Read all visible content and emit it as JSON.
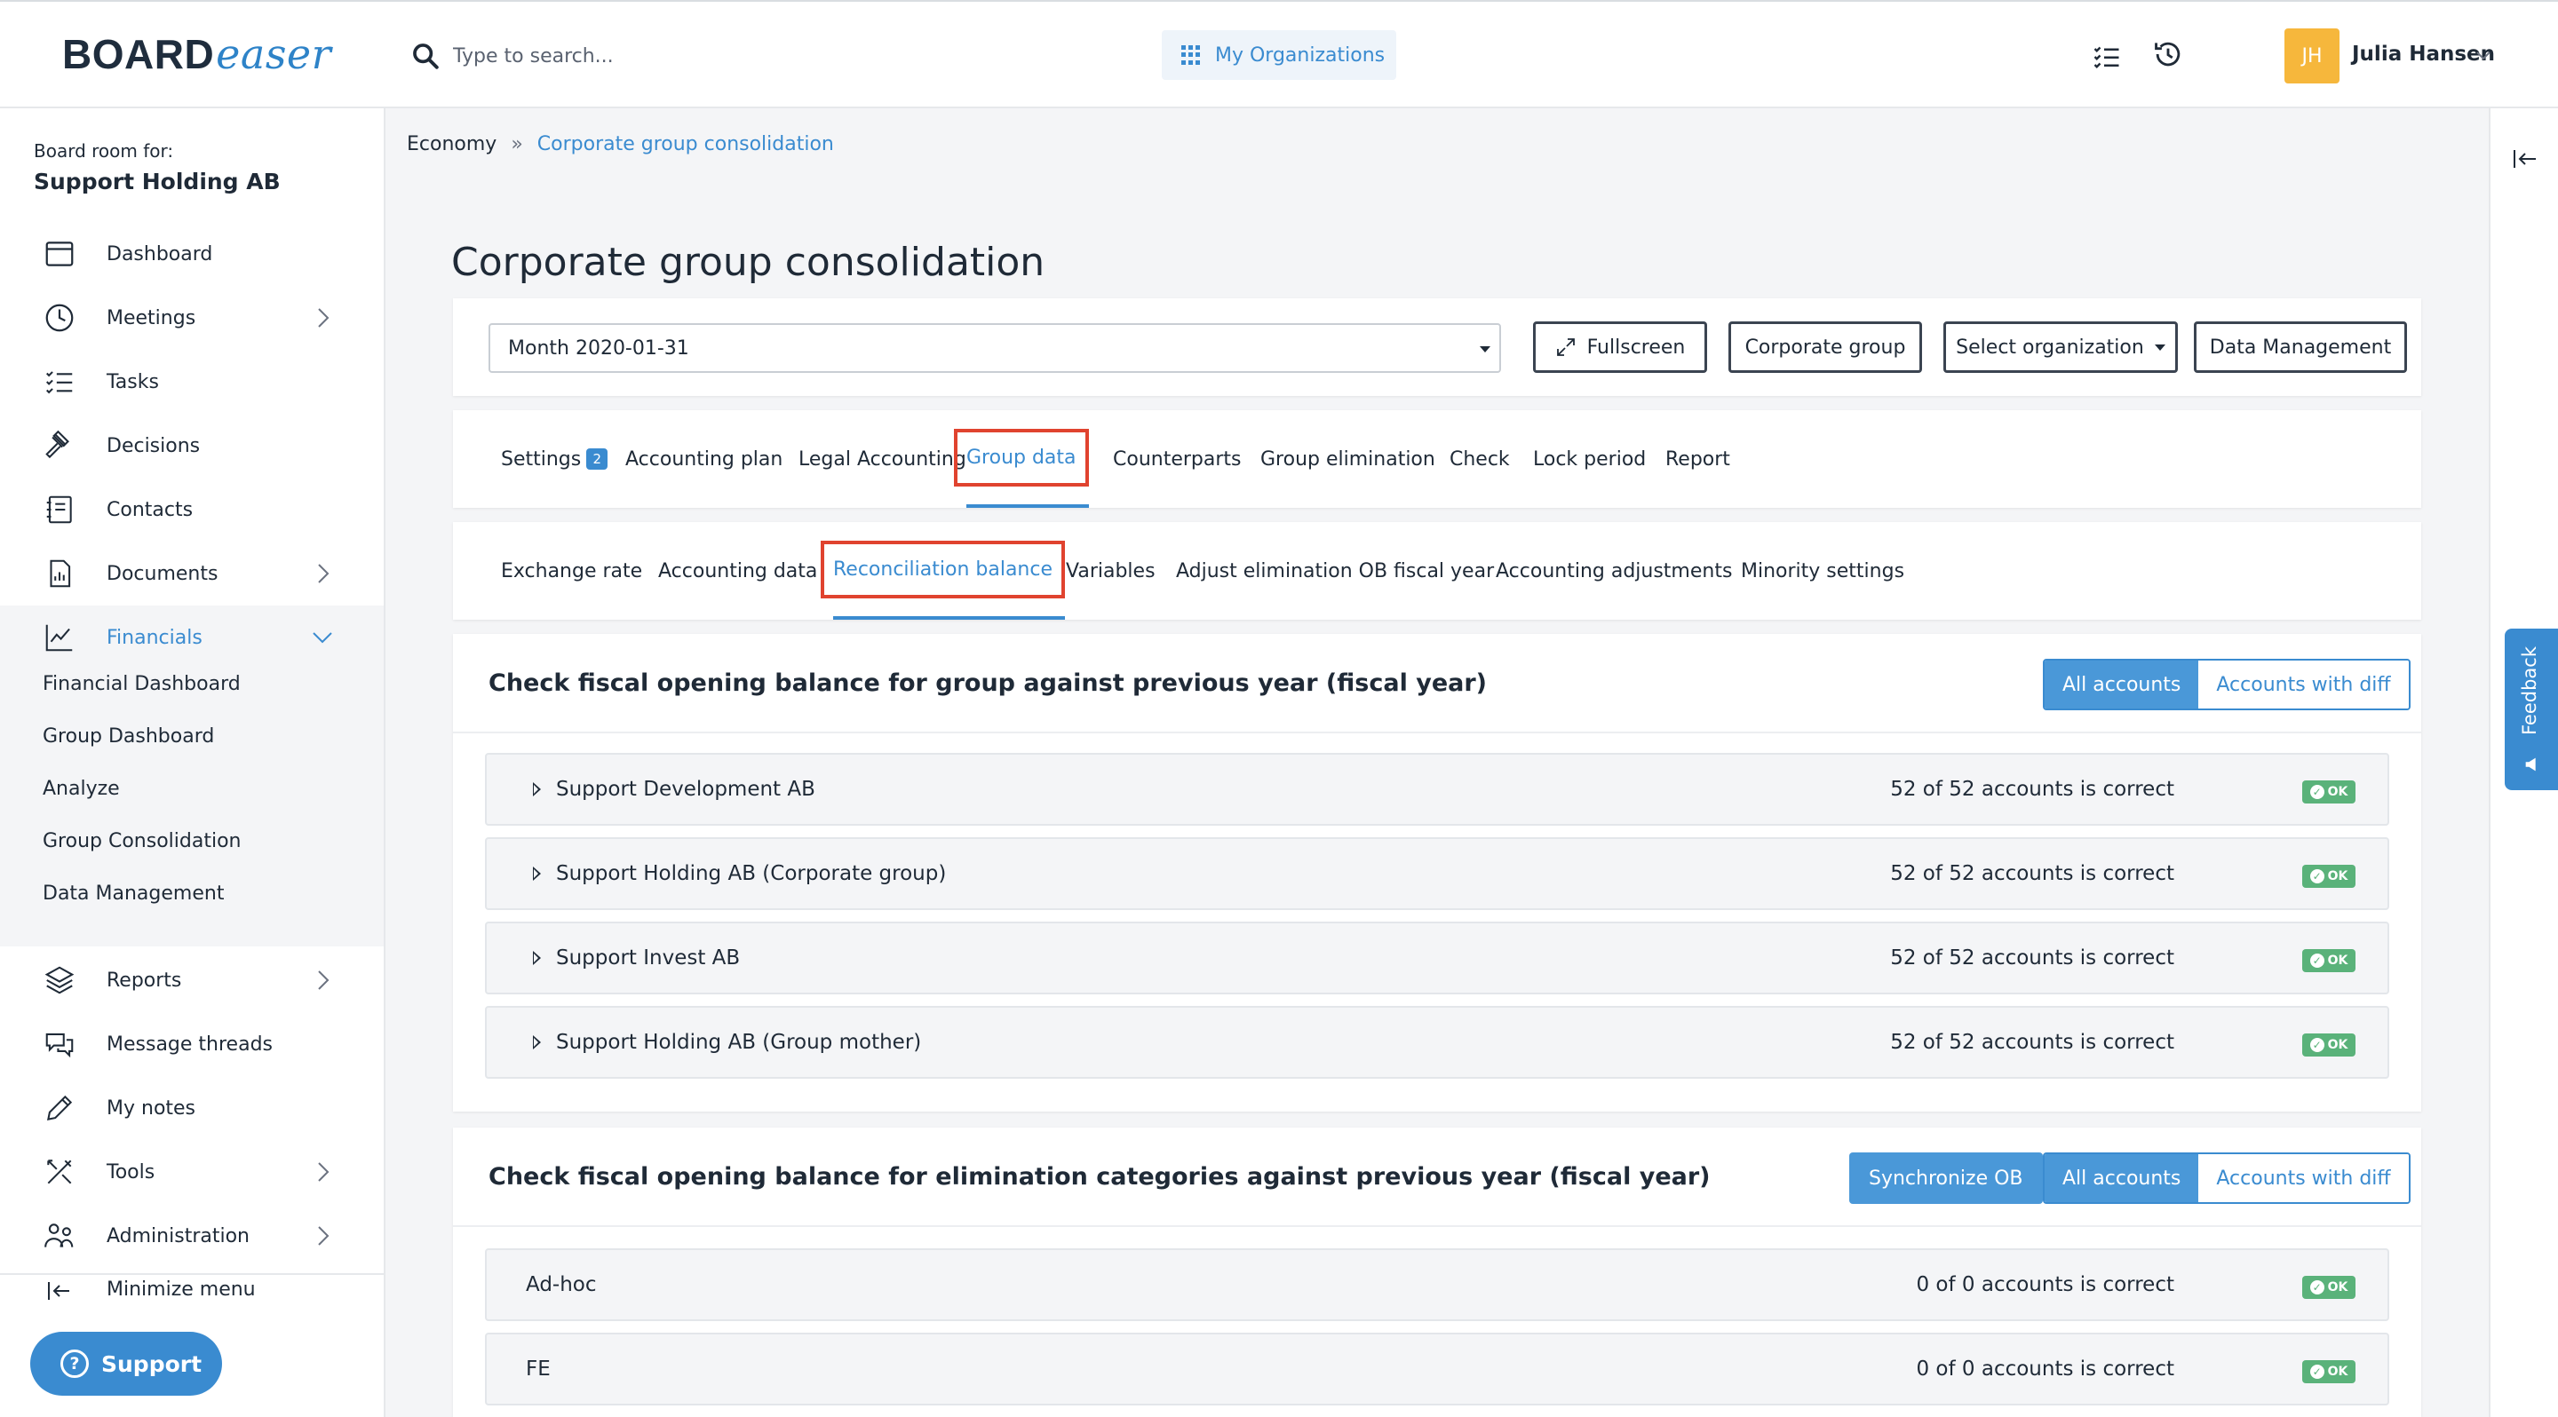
{
  "topbar": {
    "logo_board": "BOARD",
    "logo_easer": "easer",
    "search_placeholder": "Type to search...",
    "my_organizations": "My Organizations",
    "avatar_initials": "JH",
    "user_name": "Julia Hansen"
  },
  "sidebar": {
    "board_label": "Board room for:",
    "board_name": "Support Holding AB",
    "items": [
      {
        "label": "Dashboard",
        "icon": "calendar-icon"
      },
      {
        "label": "Meetings",
        "icon": "clock-icon"
      },
      {
        "label": "Tasks",
        "icon": "checklist-icon"
      },
      {
        "label": "Decisions",
        "icon": "gavel-icon"
      },
      {
        "label": "Contacts",
        "icon": "contacts-icon"
      },
      {
        "label": "Documents",
        "icon": "document-icon"
      },
      {
        "label": "Financials",
        "icon": "chart-line-icon"
      },
      {
        "label": "Reports",
        "icon": "layers-icon"
      },
      {
        "label": "Message threads",
        "icon": "chat-icon"
      },
      {
        "label": "My notes",
        "icon": "pencil-icon"
      },
      {
        "label": "Tools",
        "icon": "tools-icon"
      },
      {
        "label": "Administration",
        "icon": "users-icon"
      }
    ],
    "financials_sub": [
      "Financial Dashboard",
      "Group Dashboard",
      "Analyze",
      "Group Consolidation",
      "Data Management"
    ],
    "minimize": "Minimize menu",
    "support": "Support"
  },
  "feedback": "Feedback",
  "breadcrumb": {
    "root": "Economy",
    "current": "Corporate group consolidation"
  },
  "page_title": "Corporate group consolidation",
  "toolbar": {
    "month_value": "Month 2020-01-31",
    "fullscreen": "Fullscreen",
    "corporate_group": "Corporate group",
    "select_org": "Select organization",
    "data_management": "Data Management"
  },
  "tabs1": {
    "settings": "Settings",
    "settings_badge": "2",
    "accounting_plan": "Accounting plan",
    "legal_accounting": "Legal Accounting",
    "group_data": "Group data",
    "counterparts": "Counterparts",
    "group_elimination": "Group elimination",
    "check": "Check",
    "lock_period": "Lock period",
    "report": "Report"
  },
  "tabs2": {
    "exchange_rate": "Exchange rate",
    "accounting_data": "Accounting data",
    "reconciliation_balance": "Reconciliation balance",
    "variables": "Variables",
    "adjust_elim": "Adjust elimination OB fiscal year",
    "accounting_adjustments": "Accounting adjustments",
    "minority_settings": "Minority settings"
  },
  "section1": {
    "title": "Check fiscal opening balance for group against previous year (fiscal year)",
    "all_accounts": "All accounts",
    "accounts_with_diff": "Accounts with diff",
    "rows": [
      {
        "name": "Support Development AB",
        "status": "52 of 52 accounts is correct",
        "badge": "OK"
      },
      {
        "name": "Support Holding AB (Corporate group)",
        "status": "52 of 52 accounts is correct",
        "badge": "OK"
      },
      {
        "name": "Support Invest AB",
        "status": "52 of 52 accounts is correct",
        "badge": "OK"
      },
      {
        "name": "Support Holding AB (Group mother)",
        "status": "52 of 52 accounts is correct",
        "badge": "OK"
      }
    ]
  },
  "section2": {
    "title": "Check fiscal opening balance for elimination categories against previous year (fiscal year)",
    "synchronize": "Synchronize OB",
    "all_accounts": "All accounts",
    "accounts_with_diff": "Accounts with diff",
    "rows": [
      {
        "name": "Ad-hoc",
        "status": "0 of 0 accounts is correct",
        "badge": "OK"
      },
      {
        "name": "FE",
        "status": "0 of 0 accounts is correct",
        "badge": "OK"
      }
    ]
  },
  "colors": {
    "accent": "#3a8bd0",
    "ok_green": "#5ab27a",
    "highlight_red": "#e0432f",
    "avatar": "#f6b73c"
  }
}
